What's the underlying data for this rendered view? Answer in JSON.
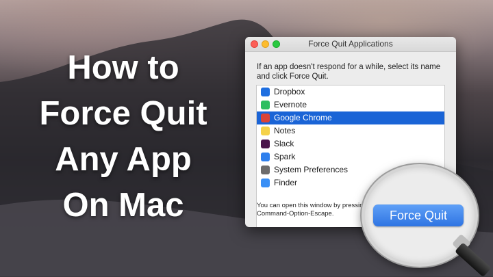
{
  "headline": [
    "How to",
    "Force Quit",
    "Any App",
    "On Mac"
  ],
  "window": {
    "title": "Force Quit Applications",
    "description": "If an app doesn't respond for a while, select its name and click Force Quit.",
    "apps": [
      {
        "name": "Dropbox",
        "icon": "dropbox-icon",
        "color": "#1f6fe0"
      },
      {
        "name": "Evernote",
        "icon": "evernote-icon",
        "color": "#2dbe60"
      },
      {
        "name": "Google Chrome",
        "icon": "chrome-icon",
        "color": "#db4437",
        "selected": true
      },
      {
        "name": "Notes",
        "icon": "notes-icon",
        "color": "#f5d24a"
      },
      {
        "name": "Slack",
        "icon": "slack-icon",
        "color": "#4a154b"
      },
      {
        "name": "Spark",
        "icon": "spark-icon",
        "color": "#2f80ed"
      },
      {
        "name": "System Preferences",
        "icon": "system-preferences-icon",
        "color": "#6c6c6c"
      },
      {
        "name": "Finder",
        "icon": "finder-icon",
        "color": "#3a8ff5"
      }
    ],
    "footer": "You can open this window by pressing Command-Option-Escape."
  },
  "magnifier": {
    "button_label": "Force Quit"
  },
  "colors": {
    "selection": "#1a64d6",
    "button": "#3d83f0"
  }
}
